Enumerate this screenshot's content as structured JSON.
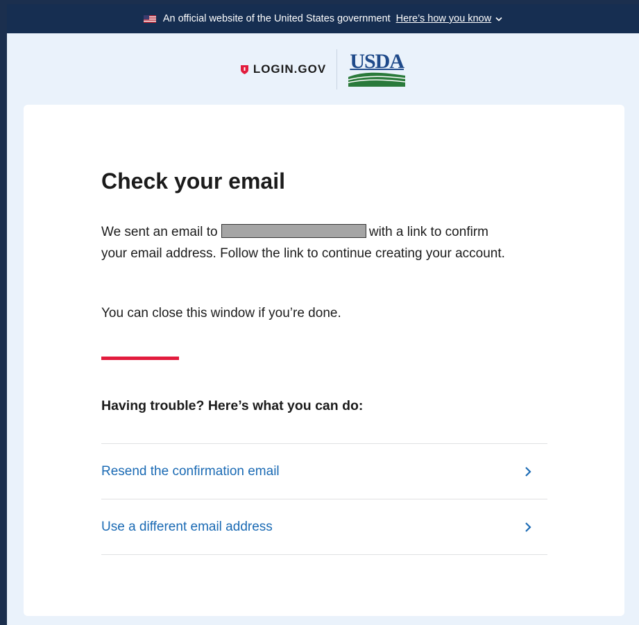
{
  "banner": {
    "text": "An official website of the United States government",
    "link_text": "Here’s how you know"
  },
  "header": {
    "login_logo_text": "LOGIN.GOV",
    "partner_logo_text": "USDA"
  },
  "content": {
    "title": "Check your email",
    "lead_prefix": "We sent an email to",
    "lead_suffix": "with a link to confirm your email address. Follow the link to continue creating your account.",
    "note": "You can close this window if you’re done.",
    "trouble_heading": "Having trouble? Here’s what you can do:",
    "options": [
      {
        "label": "Resend the confirmation email"
      },
      {
        "label": "Use a different email address"
      }
    ]
  },
  "colors": {
    "banner_bg": "#162e51",
    "page_bg": "#eaf2fb",
    "link": "#1a6ab4",
    "accent": "#e21c3d",
    "login_shield": "#e21c3d",
    "usda_blue": "#1f4a8a",
    "usda_green": "#2a7a3b"
  },
  "icons": {
    "flag": "us-flag-icon",
    "banner_toggle": "chevron-down-icon",
    "login_logo": "shield-icon",
    "option_arrow": "chevron-right-icon"
  }
}
